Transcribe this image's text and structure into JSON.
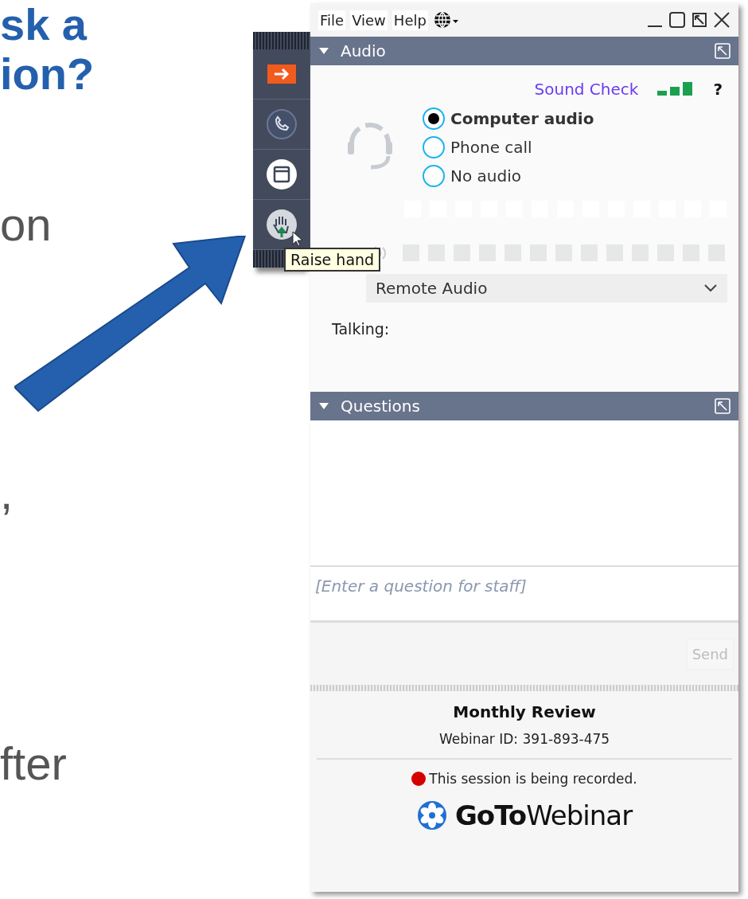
{
  "slide": {
    "title_lines": [
      "sk a",
      "ion?"
    ],
    "body_fragments": [
      {
        "text": "on"
      },
      {
        "text": ","
      },
      {
        "text": "fter"
      }
    ]
  },
  "toolbar": {
    "buttons": [
      {
        "kind": "exit"
      },
      {
        "kind": "phone"
      },
      {
        "kind": "window"
      },
      {
        "kind": "hand"
      }
    ],
    "tooltip": "Raise hand"
  },
  "window": {
    "menu": [
      "File",
      "View",
      "Help"
    ]
  },
  "audio": {
    "title": "Audio",
    "expanded": true,
    "sound_check": "Sound Check",
    "help": "?",
    "options": [
      {
        "label": "Computer audio",
        "selected": true
      },
      {
        "label": "Phone call",
        "selected": false
      },
      {
        "label": "No audio",
        "selected": false
      }
    ],
    "speaker": "Remote Audio",
    "talking_label": "Talking:"
  },
  "questions": {
    "title": "Questions",
    "expanded": true,
    "placeholder": "[Enter a question for staff]",
    "send": "Send",
    "send_disabled": true
  },
  "footer": {
    "title": "Monthly Review",
    "webinar_id": "Webinar ID: 391-893-475",
    "recording": "This session is being recorded.",
    "logo": "**GoTo**Webinar"
  }
}
